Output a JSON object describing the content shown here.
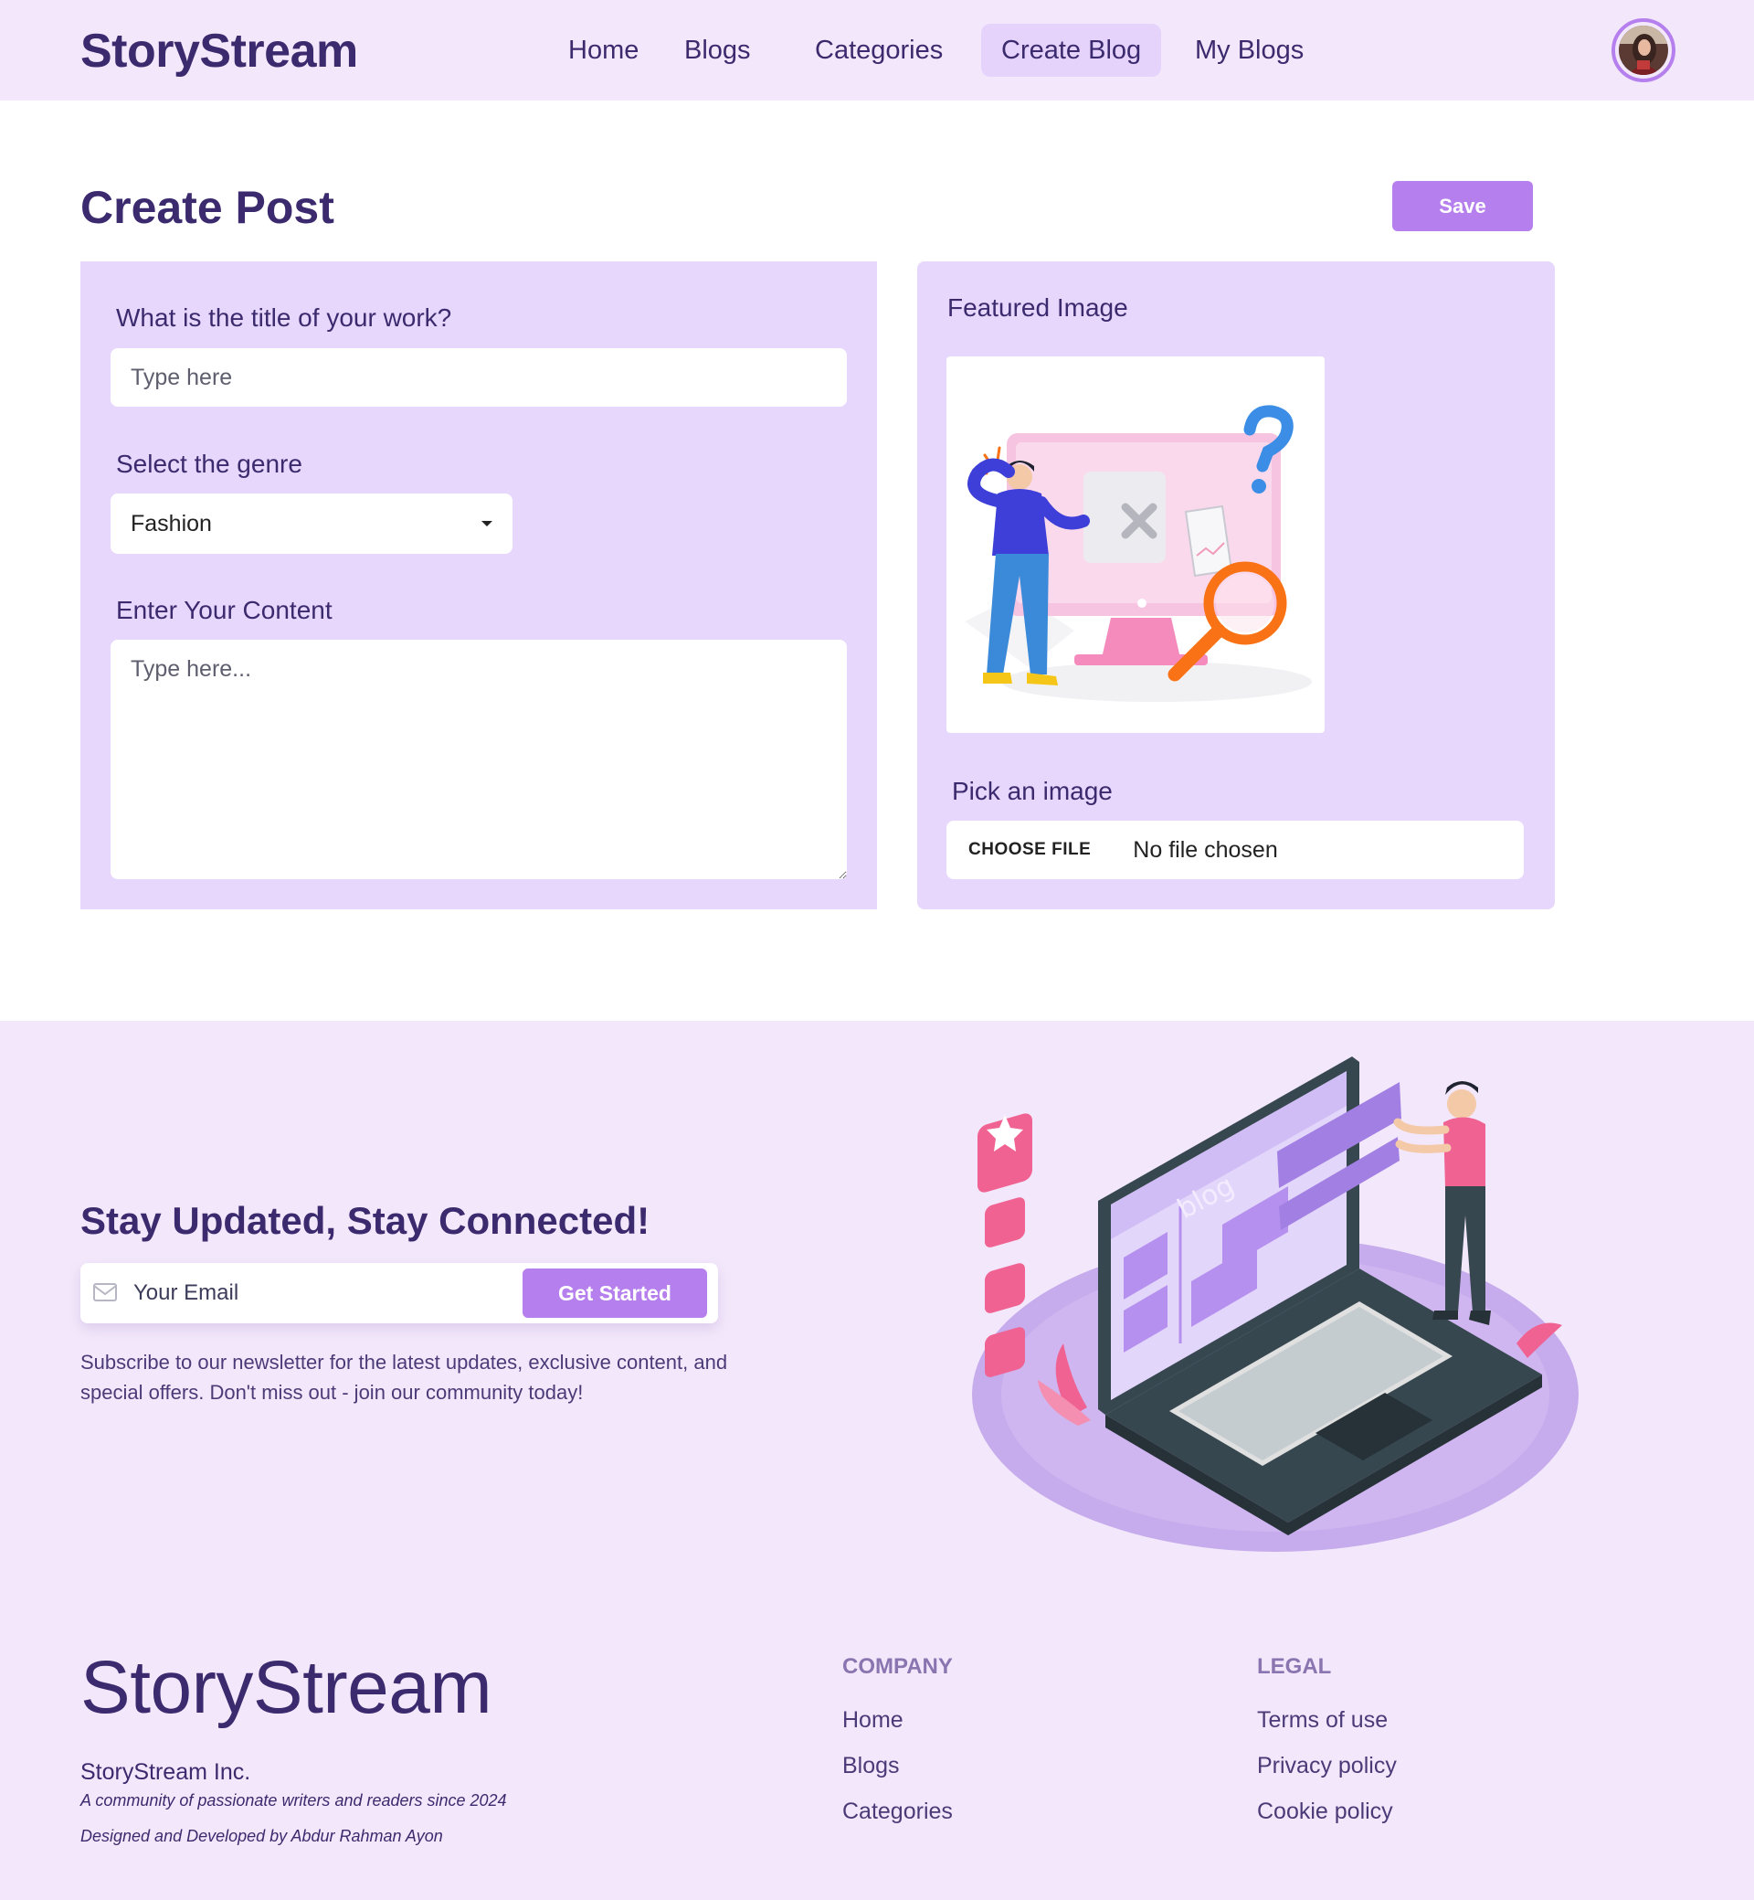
{
  "header": {
    "brand": "StoryStream",
    "nav": [
      "Home",
      "Blogs",
      "Categories",
      "Create Blog",
      "My Blogs"
    ],
    "active_nav": "Create Blog"
  },
  "create_post": {
    "title": "Create Post",
    "save_label": "Save",
    "title_label": "What is the title of your work?",
    "title_placeholder": "Type here",
    "genre_label": "Select the genre",
    "genre_value": "Fashion",
    "content_label": "Enter Your Content",
    "content_placeholder": "Type here...",
    "featured_label": "Featured Image",
    "pick_label": "Pick an image",
    "file_button": "CHOOSE FILE",
    "file_status": "No file chosen"
  },
  "newsletter": {
    "title": "Stay Updated, Stay Connected!",
    "email_placeholder": "Your Email",
    "button": "Get Started",
    "text": "Subscribe to our newsletter for the latest updates, exclusive content, and special offers. Don't miss out - join our community today!",
    "illustration_text": "blog"
  },
  "footer": {
    "brand": "StoryStream",
    "company_name": "StoryStream Inc.",
    "tagline": "A community of passionate writers and readers since 2024",
    "credits": "Designed and Developed by Abdur Rahman Ayon",
    "company_heading": "COMPANY",
    "company_links": [
      "Home",
      "Blogs",
      "Categories"
    ],
    "legal_heading": "LEGAL",
    "legal_links": [
      "Terms of use",
      "Privacy policy",
      "Cookie policy"
    ]
  },
  "colors": {
    "brand": "#3b2a6e",
    "accent": "#b57fee",
    "panel": "#e8d7fc",
    "header_bg": "#f3e8fb"
  }
}
